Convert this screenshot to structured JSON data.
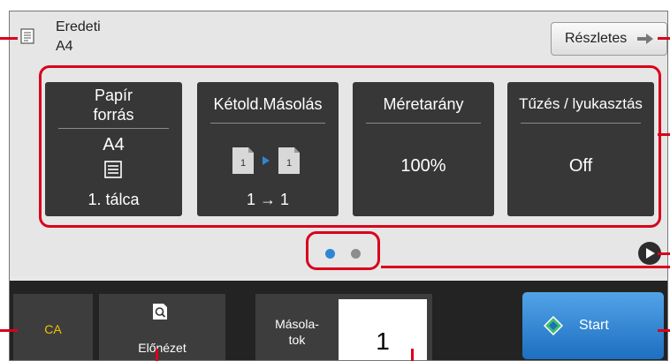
{
  "header": {
    "original_label": "Eredeti",
    "original_size": "A4",
    "details_button_label": "Részletes"
  },
  "cards": [
    {
      "title": "Papír\nforrás",
      "value": "A4",
      "bottom": "1. tálca",
      "icon": "paper-tray-icon"
    },
    {
      "title": "Kétold.Másolás",
      "value": "",
      "bottom": "1 → 1",
      "icon": "simplex-copy-icon"
    },
    {
      "title": "Méretarány",
      "value": "100%",
      "bottom": "",
      "icon": ""
    },
    {
      "title": "Tűzés / lyukasztás",
      "value": "Off",
      "bottom": "",
      "icon": ""
    }
  ],
  "pagination": {
    "pages": 2,
    "active": 1
  },
  "bottom_bar": {
    "ca_label": "CA",
    "preview_label": "Előnézet",
    "copies_label": "Másola-\ntok",
    "copies_value": "1",
    "start_label": "Start"
  },
  "colors": {
    "callout_red": "#d9001b",
    "ca_yellow": "#f2c200",
    "start_blue": "#2f86d4",
    "active_dot": "#2f86d4",
    "card_bg": "#373737"
  }
}
